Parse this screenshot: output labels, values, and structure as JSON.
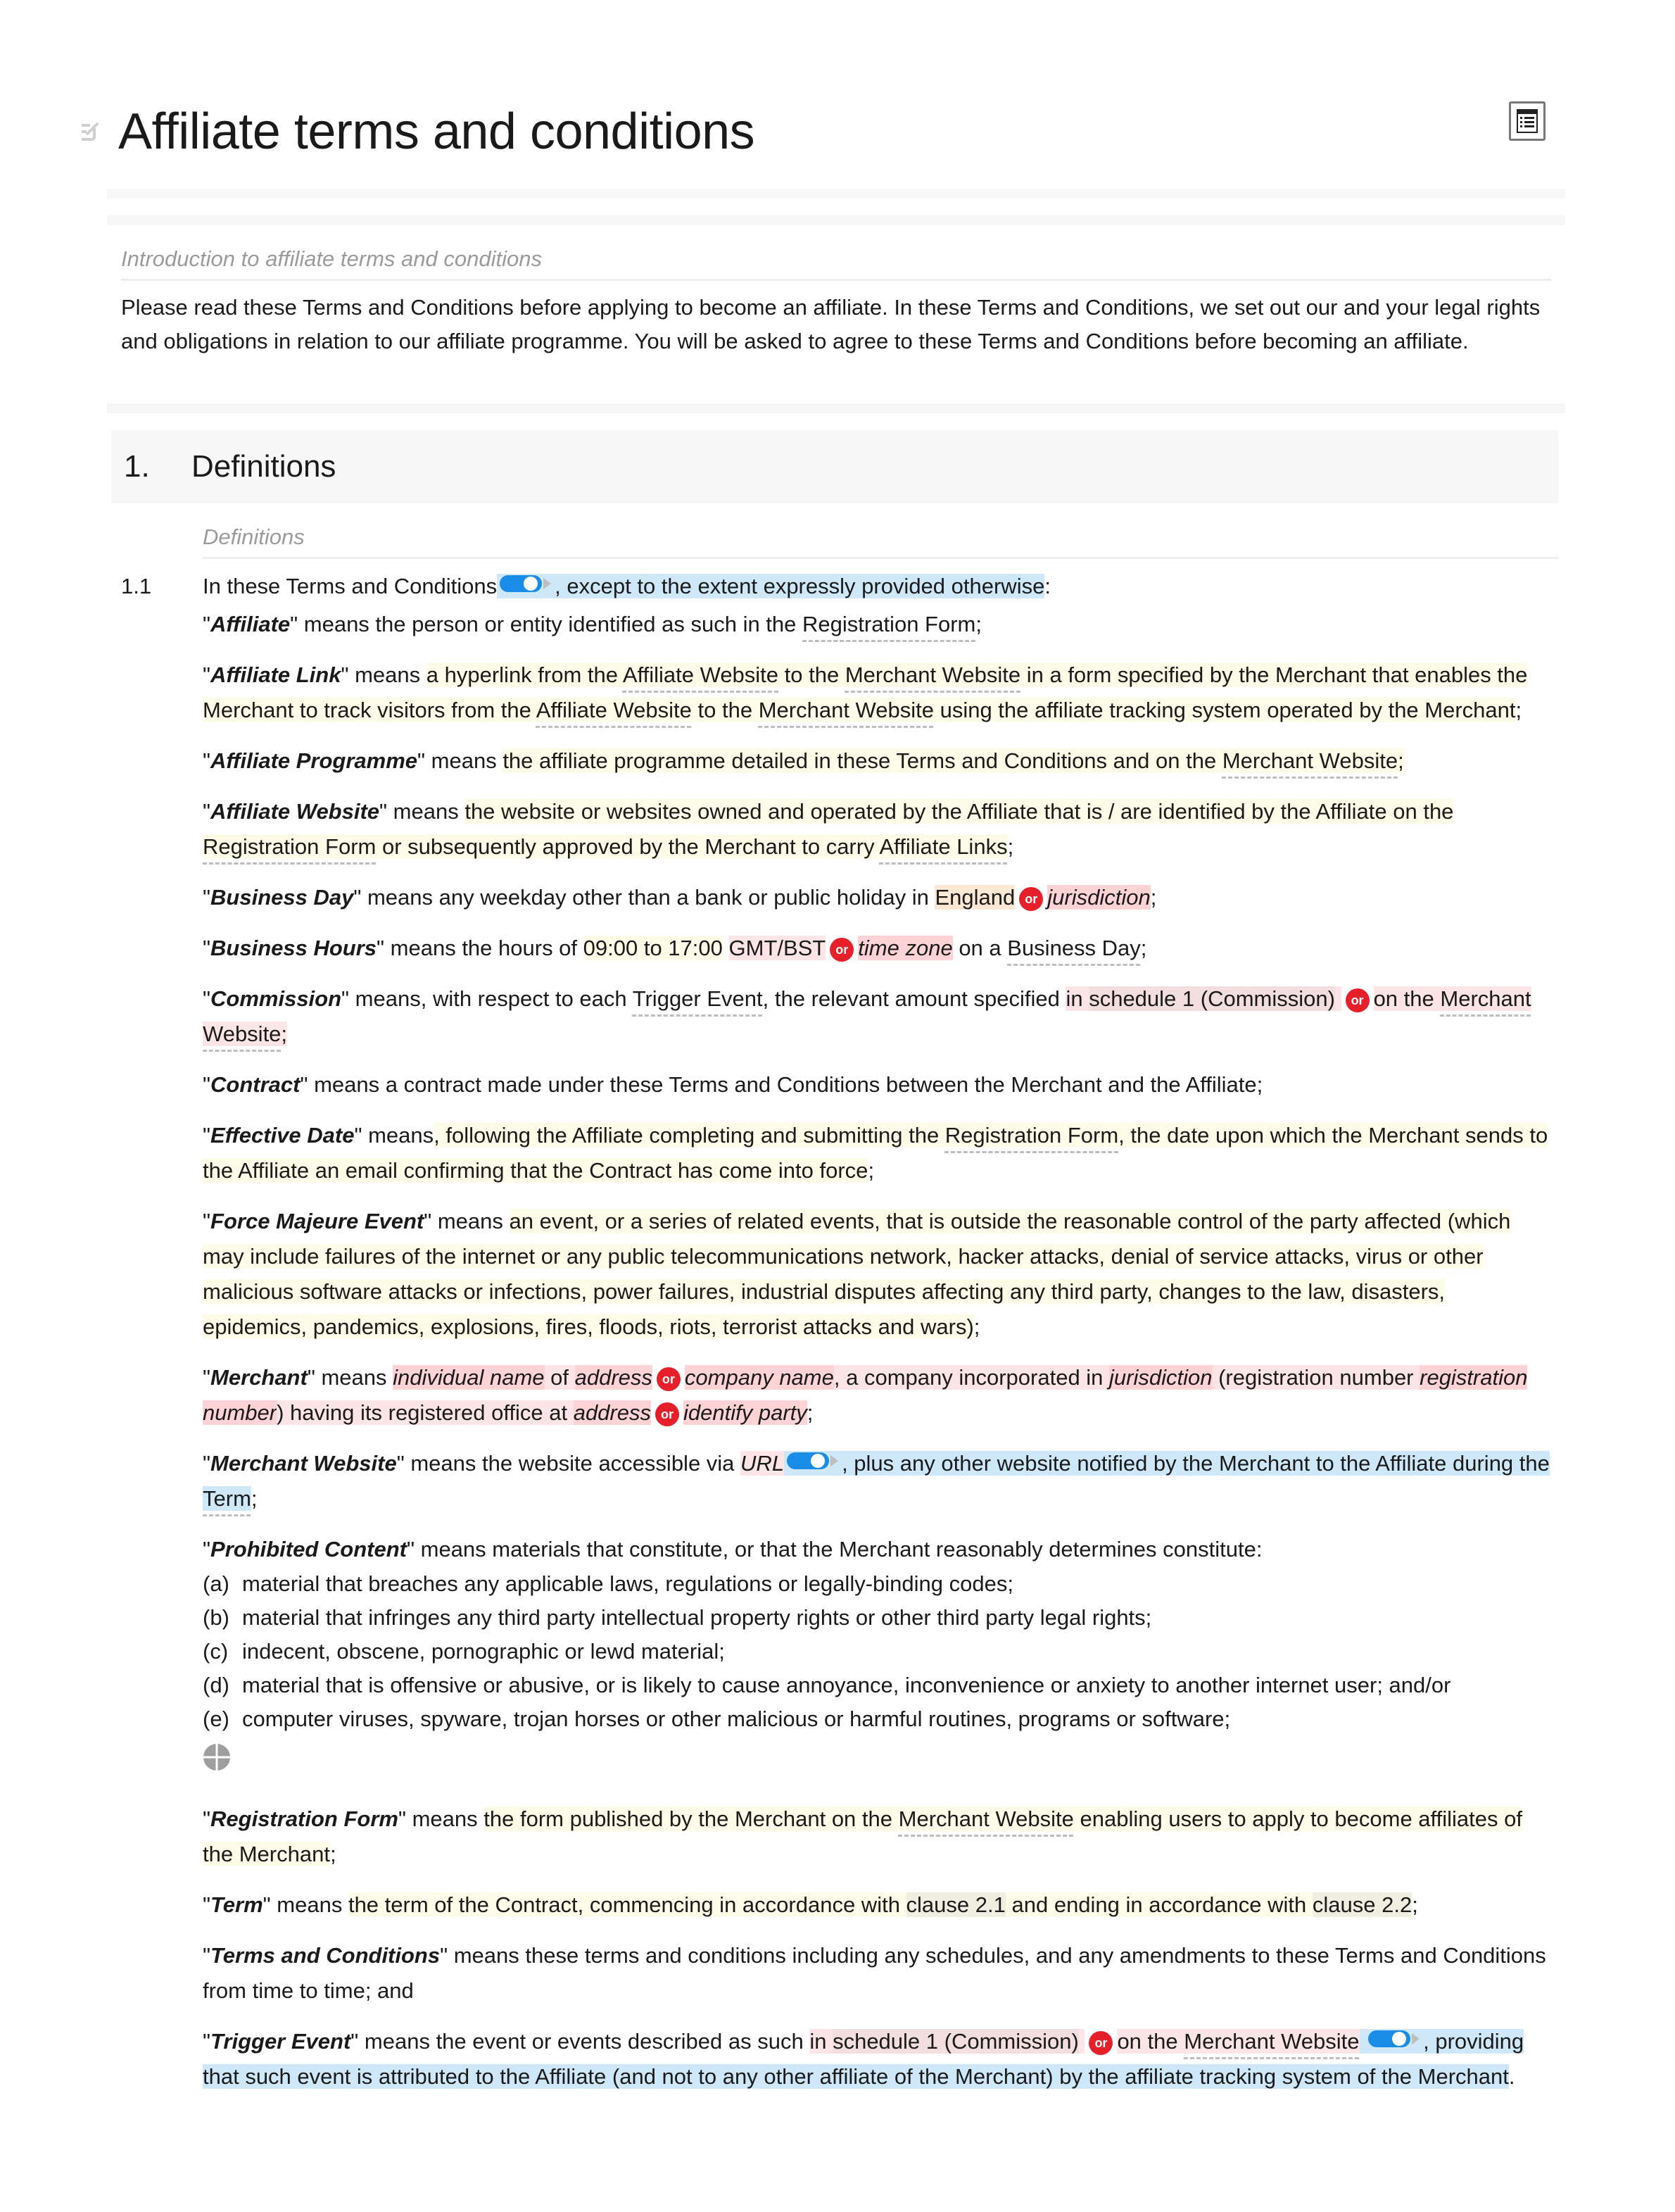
{
  "document": {
    "title": "Affiliate terms and conditions",
    "icons": {
      "edit": "edit-icon",
      "toc": "table-of-contents-icon",
      "add": "add-circle-icon",
      "toggle": "toggle-switch",
      "alternative": "or-badge"
    }
  },
  "intro": {
    "label": "Introduction to affiliate terms and conditions",
    "text": "Please read these Terms and Conditions before applying to become an affiliate. In these Terms and Conditions, we set out our and your legal rights and obligations in relation to our affiliate programme. You will be asked to agree to these Terms and Conditions before becoming an affiliate."
  },
  "section1": {
    "number": "1.",
    "title": "Definitions",
    "sublabel": "Definitions",
    "clause_number": "1.1",
    "lead": "In these Terms and Conditions",
    "lead_optional": ", except to the extent expressly provided otherwise",
    "lead_end": ":",
    "or_label": "or",
    "q": "\"",
    "means": "\" means ",
    "defs": {
      "affiliate": {
        "term": "Affiliate",
        "t1": "the person or entity identified as such in the ",
        "r1": "Registration Form",
        "t2": ";"
      },
      "affiliate_link": {
        "term": "Affiliate Link",
        "t1": "a hyperlink from the ",
        "r1": "Affiliate Website",
        "t2": " to the ",
        "r2": "Merchant Website",
        "t3": " in a form specified by the Merchant that enables the Merchant to track visitors from the ",
        "r3": "Affiliate Website",
        "t4": " to the ",
        "r4": "Merchant Website",
        "t5": " using the affiliate tracking system operated by the Merchant",
        "t6": ";"
      },
      "affiliate_programme": {
        "term": "Affiliate Programme",
        "t1": "the affiliate programme detailed in these Terms and Conditions and on the ",
        "r1": "Merchant Website",
        "t2": ";"
      },
      "affiliate_website": {
        "term": "Affiliate Website",
        "t1": "the website or websites owned and operated by the Affiliate that is / are identified by the Affiliate on the ",
        "r1": "Registration Form",
        "t2": " or subsequently approved by the Merchant to carry ",
        "r2": "Affiliate Links",
        "t3": ";"
      },
      "business_day": {
        "term": "Business Day",
        "t1": "any weekday other than a bank or public holiday in ",
        "opt1": "England",
        "opt2": "jurisdiction",
        "t2": ";"
      },
      "business_hours": {
        "term": "Business Hours",
        "t1": "the hours of ",
        "hours": "09:00 to 17:00",
        "opt1": "GMT/BST",
        "opt2": "time zone",
        "t2": " on a ",
        "r1": "Business Day",
        "t3": ";"
      },
      "commission": {
        "term": "Commission",
        "t1": "means, with respect to each ",
        "r1": "Trigger Event",
        "t2": ", the relevant amount specified ",
        "opt1a": "in ",
        "opt1b": "schedule 1 (Commission)",
        "opt2a": "on the ",
        "opt2b": "Merchant Website",
        "t3": ";"
      },
      "contract": {
        "term": "Contract",
        "t1": "a contract made under these Terms and Conditions between the Merchant and the Affiliate;"
      },
      "effective_date": {
        "term": "Effective Date",
        "t1": "means",
        "h1": ", following the Affiliate completing and submitting the ",
        "r1": "Registration Form",
        "h2": ", the date upon which the Merchant sends to the Affiliate an email confirming that the Contract has come into force",
        "t2": ";"
      },
      "force_majeure": {
        "term": "Force Majeure Event",
        "t1": "an event, or a series of related events, that is outside the reasonable control of the party affected (which may include failures of the internet or any public telecommunications network, hacker attacks, denial of service attacks, virus or other malicious software attacks or infections, power failures, industrial disputes affecting any third party, changes to the law, disasters, epidemics, pandemics, explosions, fires, floods, riots, terrorist attacks and wars)",
        "t2": ";"
      },
      "merchant": {
        "term": "Merchant",
        "v1": "individual name",
        "t1": " of ",
        "v2": "address",
        "v3": "company name",
        "t2": ", a company incorporated in ",
        "v4": "jurisdiction",
        "t3": " (registration number ",
        "v5": "registration number",
        "t4": ") having its registered office at ",
        "v6": "address",
        "v7": "identify party",
        "t5": ";"
      },
      "merchant_website": {
        "term": "Merchant Website",
        "t1": "the website accessible via ",
        "v1": "URL",
        "h1": ", plus any other website notified by the Merchant to the Affiliate during the ",
        "r1": "Term",
        "t2": ";"
      },
      "prohibited_content": {
        "term": "Prohibited Content",
        "t1": "materials that constitute, or that the Merchant reasonably determines constitute:",
        "items": [
          {
            "label": "(a)",
            "text": "material that breaches any applicable laws, regulations or legally-binding codes;"
          },
          {
            "label": "(b)",
            "text": "material that infringes any third party intellectual property rights or other third party legal rights;"
          },
          {
            "label": "(c)",
            "text": "indecent, obscene, pornographic or lewd material;"
          },
          {
            "label": "(d)",
            "text": "material that is offensive or abusive, or is likely to cause annoyance, inconvenience or anxiety to another internet user; and/or"
          },
          {
            "label": "(e)",
            "text": "computer viruses, spyware, trojan horses or other malicious or harmful routines, programs or software;"
          }
        ]
      },
      "registration_form": {
        "term": "Registration Form",
        "t1": "the form published by the Merchant on the ",
        "r1": "Merchant Website",
        "t2": " enabling users to apply to become affiliates of the Merchant",
        "t3": ";"
      },
      "term_def": {
        "term": "Term",
        "t1": "the term of the Contract, commencing in accordance with ",
        "r1": "clause 2.1",
        "t2": " and ending in accordance with ",
        "r2": "clause 2.2",
        "t3": ";"
      },
      "terms_and_conditions": {
        "term": "Terms and Conditions",
        "t1": "these terms and conditions including any schedules, and any amendments to these Terms and Conditions from time to time; and"
      },
      "trigger_event": {
        "term": "Trigger Event",
        "t1": "the event or events described as such ",
        "opt1a": "in ",
        "opt1b": "schedule 1 (Commission)",
        "opt2a": "on the ",
        "opt2b": "Merchant Website",
        "h1": ", providing that such event is attributed to the Affiliate (and not to any other affiliate of the Merchant) by the affiliate tracking system of the Merchant",
        "t2": "."
      }
    }
  }
}
